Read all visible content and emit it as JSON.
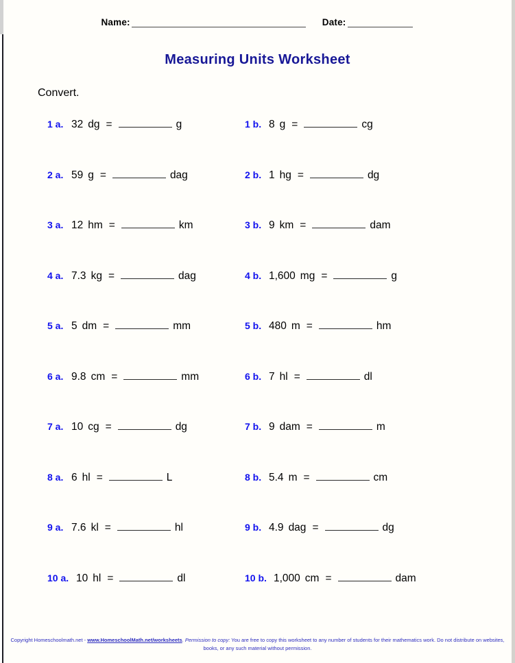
{
  "page": {
    "header": {
      "name_label": "Name:",
      "date_label": "Date:"
    },
    "title": "Measuring Units Worksheet",
    "instruction": "Convert."
  },
  "problems": [
    {
      "a": {
        "number": "1 a.",
        "value": "32",
        "from_unit": "dg",
        "equals": "=",
        "to_unit": "g"
      },
      "b": {
        "number": "1 b.",
        "value": "8",
        "from_unit": "g",
        "equals": "=",
        "to_unit": "cg"
      }
    },
    {
      "a": {
        "number": "2 a.",
        "value": "59",
        "from_unit": "g",
        "equals": "=",
        "to_unit": "dag"
      },
      "b": {
        "number": "2 b.",
        "value": "1",
        "from_unit": "hg",
        "equals": "=",
        "to_unit": "dg"
      }
    },
    {
      "a": {
        "number": "3 a.",
        "value": "12",
        "from_unit": "hm",
        "equals": "=",
        "to_unit": "km"
      },
      "b": {
        "number": "3 b.",
        "value": "9",
        "from_unit": "km",
        "equals": "=",
        "to_unit": "dam"
      }
    },
    {
      "a": {
        "number": "4 a.",
        "value": "7.3",
        "from_unit": "kg",
        "equals": "=",
        "to_unit": "dag"
      },
      "b": {
        "number": "4 b.",
        "value": "1,600",
        "from_unit": "mg",
        "equals": "=",
        "to_unit": "g"
      }
    },
    {
      "a": {
        "number": "5 a.",
        "value": "5",
        "from_unit": "dm",
        "equals": "=",
        "to_unit": "mm"
      },
      "b": {
        "number": "5 b.",
        "value": "480",
        "from_unit": "m",
        "equals": "=",
        "to_unit": "hm"
      }
    },
    {
      "a": {
        "number": "6 a.",
        "value": "9.8",
        "from_unit": "cm",
        "equals": "=",
        "to_unit": "mm"
      },
      "b": {
        "number": "6 b.",
        "value": "7",
        "from_unit": "hl",
        "equals": "=",
        "to_unit": "dl"
      }
    },
    {
      "a": {
        "number": "7 a.",
        "value": "10",
        "from_unit": "cg",
        "equals": "=",
        "to_unit": "dg"
      },
      "b": {
        "number": "7 b.",
        "value": "9",
        "from_unit": "dam",
        "equals": "=",
        "to_unit": "m"
      }
    },
    {
      "a": {
        "number": "8 a.",
        "value": "6",
        "from_unit": "hl",
        "equals": "=",
        "to_unit": "L"
      },
      "b": {
        "number": "8 b.",
        "value": "5.4",
        "from_unit": "m",
        "equals": "=",
        "to_unit": "cm"
      }
    },
    {
      "a": {
        "number": "9 a.",
        "value": "7.6",
        "from_unit": "kl",
        "equals": "=",
        "to_unit": "hl"
      },
      "b": {
        "number": "9 b.",
        "value": "4.9",
        "from_unit": "dag",
        "equals": "=",
        "to_unit": "dg"
      }
    },
    {
      "a": {
        "number": "10 a.",
        "value": "10",
        "from_unit": "hl",
        "equals": "=",
        "to_unit": "dl"
      },
      "b": {
        "number": "10 b.",
        "value": "1,000",
        "from_unit": "cm",
        "equals": "=",
        "to_unit": "dam"
      }
    }
  ],
  "footer": {
    "copyright_prefix": "Copyright Homeschoolmath.net - ",
    "url": "www.HomeschoolMath.net/worksheets",
    "permission_label": ". Permission to copy:",
    "permission_text": " You are free to copy this worksheet to any number of students for their mathematics work. Do not distribute on websites, books, or any such material without permission."
  },
  "colors": {
    "title": "#171796",
    "question_number": "#1111ee",
    "footer": "#2b2bbe",
    "text": "#000000"
  }
}
